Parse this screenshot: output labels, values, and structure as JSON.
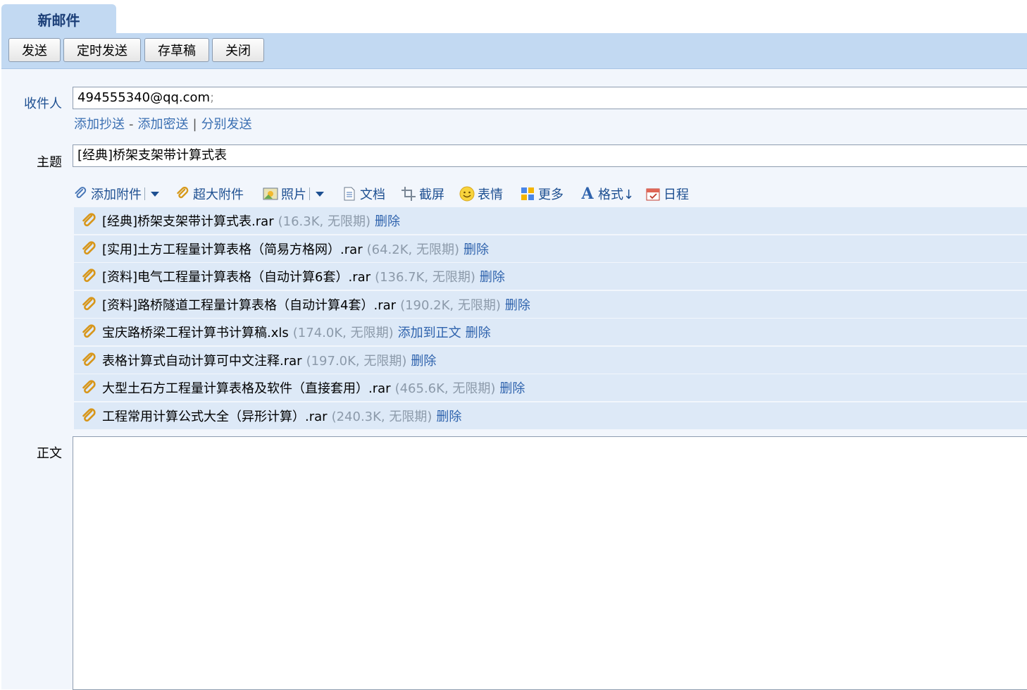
{
  "tab": {
    "title": "新邮件"
  },
  "toolbar": {
    "send": "发送",
    "schedule_send": "定时发送",
    "save_draft": "存草稿",
    "close": "关闭"
  },
  "recipient": {
    "label": "收件人",
    "value": "494555340@qq.com",
    "separator": ";",
    "add_cc": "添加抄送",
    "add_bcc": "添加密送",
    "separate_send": "分别发送",
    "dash": "-",
    "bar": "|"
  },
  "subject": {
    "label": "主题",
    "value": "[经典]桥架支架带计算式表"
  },
  "attach_toolbar": {
    "add_attachment": "添加附件",
    "large_attachment": "超大附件",
    "photo": "照片",
    "document": "文档",
    "screenshot": "截屏",
    "emoji": "表情",
    "more": "更多",
    "format": "格式↓",
    "schedule": "日程"
  },
  "attachments": [
    {
      "name": "[经典]桥架支架带计算式表.rar",
      "meta": "(16.3K, 无限期)",
      "actions": [
        "删除"
      ]
    },
    {
      "name": "[实用]土方工程量计算表格（简易方格网）.rar",
      "meta": "(64.2K, 无限期)",
      "actions": [
        "删除"
      ]
    },
    {
      "name": "[资料]电气工程量计算表格（自动计算6套）.rar",
      "meta": "(136.7K, 无限期)",
      "actions": [
        "删除"
      ]
    },
    {
      "name": "[资料]路桥隧道工程量计算表格（自动计算4套）.rar",
      "meta": "(190.2K, 无限期)",
      "actions": [
        "删除"
      ]
    },
    {
      "name": "宝庆路桥梁工程计算书计算稿.xls",
      "meta": "(174.0K, 无限期)",
      "actions": [
        "添加到正文",
        "删除"
      ]
    },
    {
      "name": "表格计算式自动计算可中文注释.rar",
      "meta": "(197.0K, 无限期)",
      "actions": [
        "删除"
      ]
    },
    {
      "name": "大型土石方工程量计算表格及软件（直接套用）.rar",
      "meta": "(465.6K, 无限期)",
      "actions": [
        "删除"
      ]
    },
    {
      "name": "工程常用计算公式大全（异形计算）.rar",
      "meta": "(240.3K, 无限期)",
      "actions": [
        "删除"
      ]
    }
  ],
  "body": {
    "label": "正文"
  },
  "colors": {
    "tab_bg": "#c2d9f2",
    "page_bg": "#f2f6fc",
    "attach_row_bg": "#dde9f7",
    "link": "#2f63ad"
  }
}
